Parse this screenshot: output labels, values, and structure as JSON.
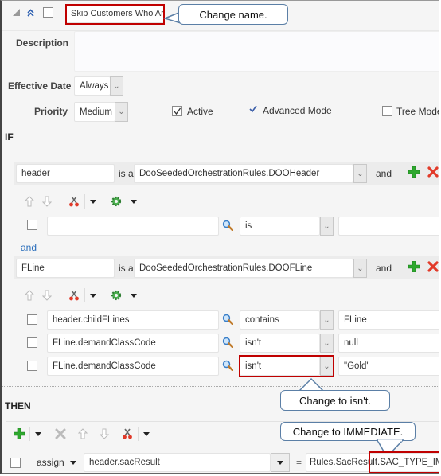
{
  "rule": {
    "name_value": "Skip Customers Who Ar",
    "description_label": "Description",
    "description_value": "",
    "effective_date_label": "Effective Date",
    "effective_date_value": "Always",
    "priority_label": "Priority",
    "priority_value": "Medium",
    "active_label": "Active",
    "active_checked": true,
    "advanced_mode_label": "Advanced Mode",
    "tree_mode_label": "Tree Mode",
    "tree_mode_checked": false
  },
  "if_section": {
    "title": "IF",
    "patterns": [
      {
        "variable": "header",
        "is_a_label": "is a",
        "type": "DooSeededOrchestrationRules.DOOHeader",
        "conjunction": "and",
        "conditions": [
          {
            "left": "",
            "operator": "is",
            "right": ""
          }
        ]
      },
      {
        "variable": "FLine",
        "is_a_label": "is a",
        "type": "DooSeededOrchestrationRules.DOOFLine",
        "conjunction": "and",
        "conditions": [
          {
            "left": "header.childFLines",
            "operator": "contains",
            "right": "FLine"
          },
          {
            "left": "FLine.demandClassCode",
            "operator": "isn't",
            "right": "null"
          },
          {
            "left": "FLine.demandClassCode",
            "operator": "isn't",
            "right": "\"Gold\""
          }
        ]
      }
    ],
    "between_patterns_link": "and"
  },
  "then_section": {
    "title": "THEN",
    "action": {
      "verb": "assign",
      "target": "header.sacResult",
      "equals": "=",
      "value_prefix": "Rules.SacResult.",
      "value_highlight": "SAC_TYPE_IMME"
    }
  },
  "callouts": {
    "name": "Change name.",
    "operator": "Change to isn't.",
    "value": "Change to IMMEDIATE."
  },
  "colors": {
    "highlight_red": "#c00000",
    "callout_border": "#5b7fa6",
    "add_green": "#2ea82e",
    "delete_red": "#e23b2a",
    "link_blue": "#2a6ebb"
  }
}
